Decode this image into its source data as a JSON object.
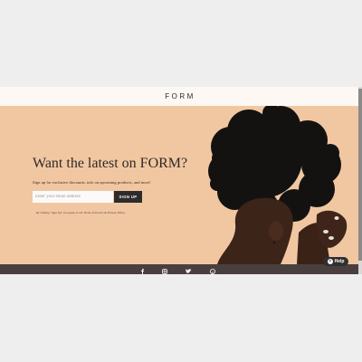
{
  "header": {
    "logo_text": "FORM"
  },
  "hero": {
    "headline": "Want the latest on FORM?",
    "subtext": "Sign up for exclusive discounts, info on upcoming products, and more!",
    "email_placeholder": "Enter your email address",
    "signup_label": "SIGN UP",
    "legal_text": "By clicking \"Sign Up\" you agree to our Terms of Service & Privacy Policy."
  },
  "footer": {
    "social_icons": [
      "facebook-icon",
      "instagram-icon",
      "twitter-icon",
      "pinterest-icon"
    ]
  },
  "help": {
    "label": "Help"
  },
  "colors": {
    "hero_bg": "#f1c7a2",
    "header_bg": "#fdf8f4",
    "footer_bg": "#4a3f3f",
    "button_bg": "#2e2b2b"
  }
}
